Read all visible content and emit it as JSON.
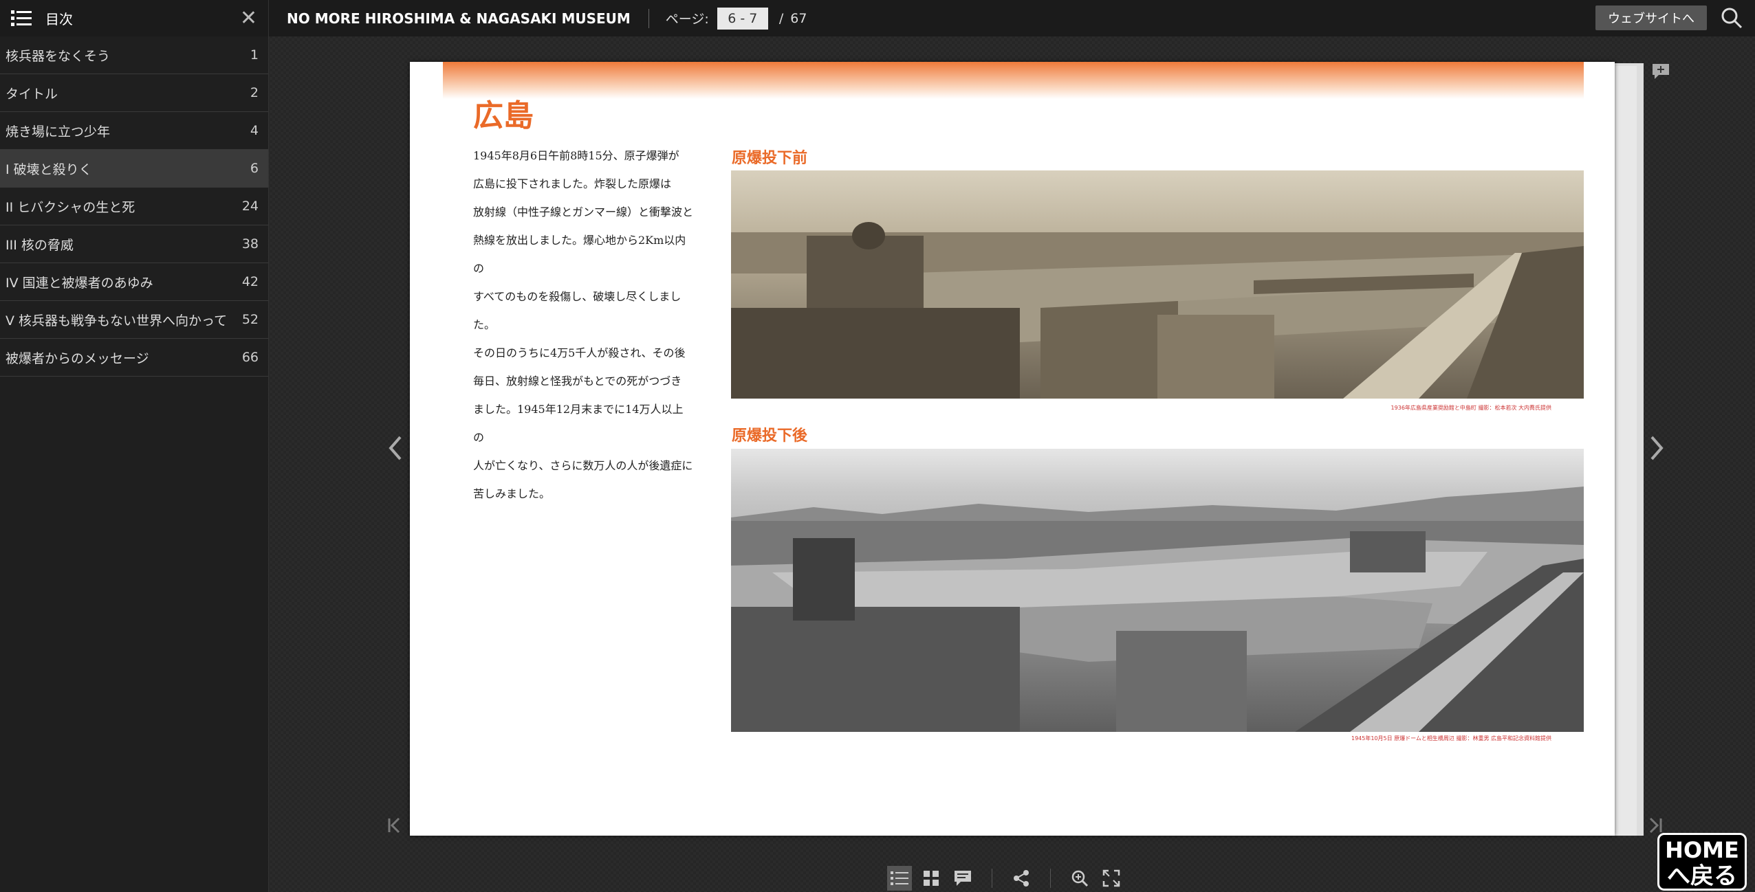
{
  "sidebar": {
    "title": "目次",
    "items": [
      {
        "label": "核兵器をなくそう",
        "page": "1"
      },
      {
        "label": "タイトル",
        "page": "2"
      },
      {
        "label": "焼き場に立つ少年",
        "page": "4"
      },
      {
        "label": "I 破壊と殺りく",
        "page": "6"
      },
      {
        "label": "II ヒバクシャの生と死",
        "page": "24"
      },
      {
        "label": "III 核の脅威",
        "page": "38"
      },
      {
        "label": "IV 国連と被爆者のあゆみ",
        "page": "42"
      },
      {
        "label": "V 核兵器も戦争もない世界へ向かって",
        "page": "52"
      },
      {
        "label": "被爆者からのメッセージ",
        "page": "66"
      }
    ]
  },
  "header": {
    "brand": "NO MORE HIROSHIMA & NAGASAKI MUSEUM",
    "page_label": "ページ:",
    "page_value": "6 - 7",
    "page_separator": "/",
    "page_total": "67",
    "website_button": "ウェブサイトへ"
  },
  "spread": {
    "title": "広島",
    "body": "1945年8月6日午前8時15分、原子爆弾が\n広島に投下されました。炸裂した原爆は\n放射線（中性子線とガンマー線）と衝撃波と\n熱線を放出しました。爆心地から2Km以内の\nすべてのものを殺傷し、破壊し尽くしました。\nその日のうちに4万5千人が殺され、その後\n毎日、放射線と怪我がもとでの死がつづき\nました。1945年12月末までに14万人以上の\n人が亡くなり、さらに数万人の人が後遺症に\n苦しみました。",
    "caption_before": "原爆投下前",
    "caption_after": "原爆投下後",
    "credit_before": "1936年広島県産業奨励館と中島町 撮影：松本若次 大内喬氏提供",
    "credit_after": "1945年10月5日 原爆ドームと相生橋周辺 撮影：林重男 広島平和記念資料館提供"
  },
  "home_button": {
    "line1": "HOME",
    "line2": "へ戻る"
  },
  "colors": {
    "accent": "#ea6a28",
    "topbar": "#1b1b1b",
    "sidebar": "#1f1f1f"
  }
}
